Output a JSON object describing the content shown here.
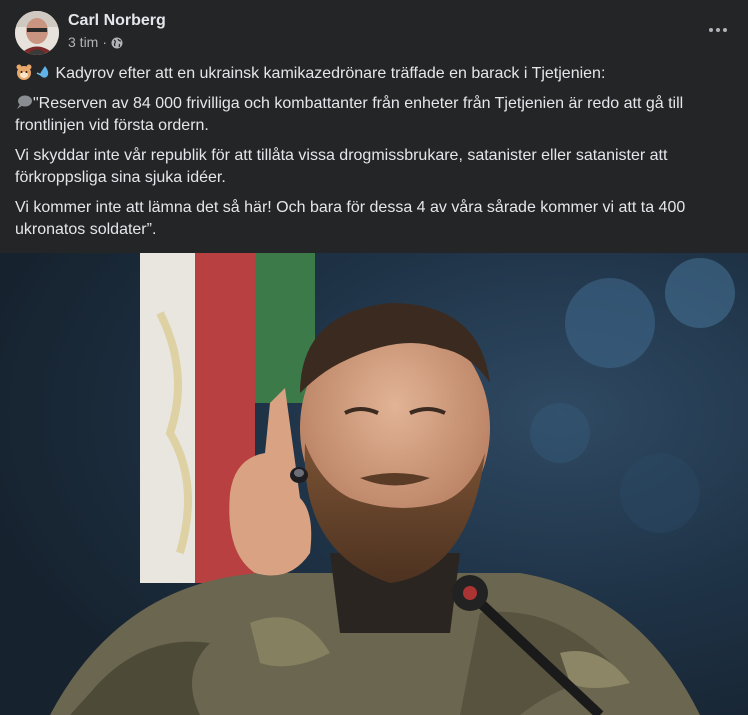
{
  "post": {
    "author_name": "Carl Norberg",
    "timestamp": "3 tim",
    "separator": "·",
    "audience_icon": "globe-icon",
    "menu_icon": "more-options-icon",
    "lines": {
      "intro": "Kadyrov efter att en ukrainsk kamikazedrönare träffade en barack i Tjetjenien:",
      "quote1": "\"Reserven av 84 000 frivilliga och kombattanter från enheter från Tjetjenien är redo att gå till frontlinjen vid första ordern.",
      "quote2": "Vi skyddar inte vår republik för att tillåta vissa drogmissbrukare, satanister eller satanister att förkroppsliga sina sjuka idéer.",
      "quote3": "Vi kommer inte att lämna det så här! Och bara för dessa 4 av våra sårade kommer vi att ta 400 ukronatos soldater”."
    },
    "emojis": {
      "intro": [
        "hamster-icon",
        "droplet-icon"
      ],
      "quote1": "speech-bubble-icon"
    }
  },
  "colors": {
    "card_background": "#242526",
    "text_primary": "#e4e6eb",
    "text_secondary": "#b0b3b8"
  }
}
